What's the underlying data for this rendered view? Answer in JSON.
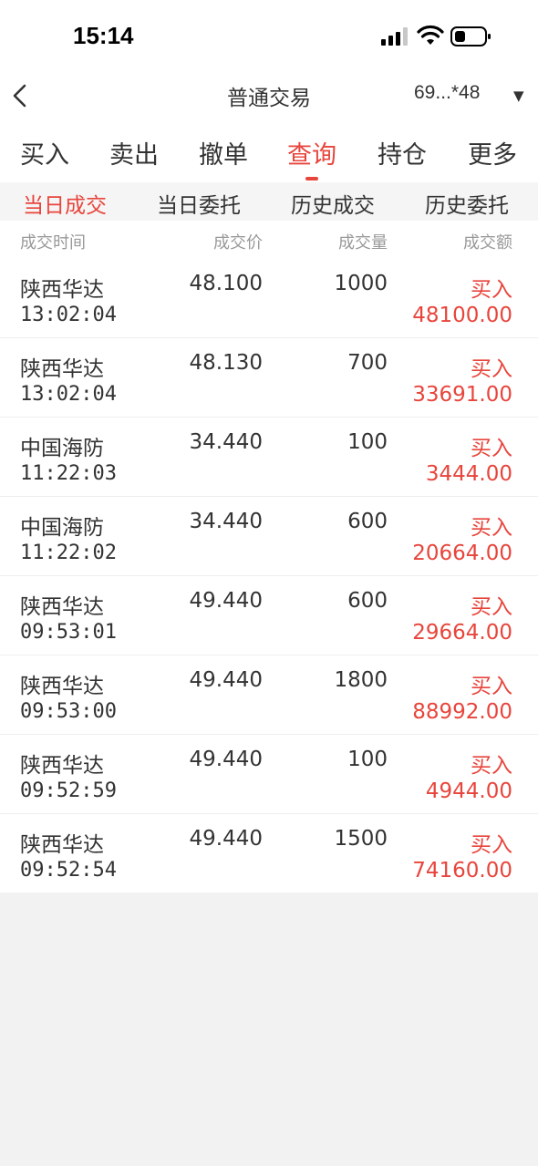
{
  "status_bar": {
    "time": "15:14",
    "icons": [
      "signal-icon",
      "wifi-icon",
      "battery-icon"
    ]
  },
  "header": {
    "title": "普通交易",
    "account": "69...*48",
    "back_icon": "chevron-left-icon",
    "dropdown_icon": "▼"
  },
  "main_tabs": [
    {
      "label": "买入",
      "active": false
    },
    {
      "label": "卖出",
      "active": false
    },
    {
      "label": "撤单",
      "active": false
    },
    {
      "label": "查询",
      "active": true
    },
    {
      "label": "持仓",
      "active": false
    },
    {
      "label": "更多",
      "active": false
    }
  ],
  "sub_tabs": [
    {
      "label": "当日成交",
      "active": true
    },
    {
      "label": "当日委托",
      "active": false
    },
    {
      "label": "历史成交",
      "active": false
    },
    {
      "label": "历史委托",
      "active": false
    }
  ],
  "columns": [
    "成交时间",
    "成交价",
    "成交量",
    "成交额"
  ],
  "trades": [
    {
      "name": "陕西华达",
      "time": "13:02:04",
      "price": "48.100",
      "volume": "1000",
      "side": "买入",
      "amount": "48100.00"
    },
    {
      "name": "陕西华达",
      "time": "13:02:04",
      "price": "48.130",
      "volume": "700",
      "side": "买入",
      "amount": "33691.00"
    },
    {
      "name": "中国海防",
      "time": "11:22:03",
      "price": "34.440",
      "volume": "100",
      "side": "买入",
      "amount": "3444.00"
    },
    {
      "name": "中国海防",
      "time": "11:22:02",
      "price": "34.440",
      "volume": "600",
      "side": "买入",
      "amount": "20664.00"
    },
    {
      "name": "陕西华达",
      "time": "09:53:01",
      "price": "49.440",
      "volume": "600",
      "side": "买入",
      "amount": "29664.00"
    },
    {
      "name": "陕西华达",
      "time": "09:53:00",
      "price": "49.440",
      "volume": "1800",
      "side": "买入",
      "amount": "88992.00"
    },
    {
      "name": "陕西华达",
      "time": "09:52:59",
      "price": "49.440",
      "volume": "100",
      "side": "买入",
      "amount": "4944.00"
    },
    {
      "name": "陕西华达",
      "time": "09:52:54",
      "price": "49.440",
      "volume": "1500",
      "side": "买入",
      "amount": "74160.00"
    }
  ],
  "colors": {
    "accent": "#e8453c",
    "text": "#333333",
    "muted": "#999999",
    "background": "#f2f2f2"
  }
}
